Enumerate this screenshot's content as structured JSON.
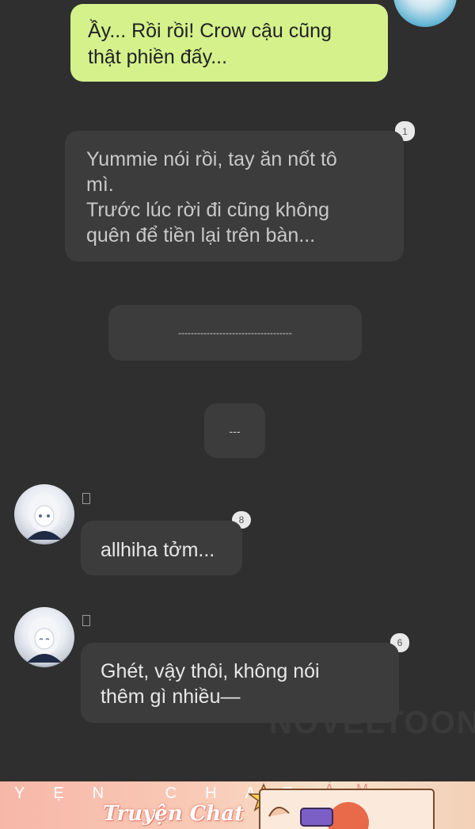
{
  "messages": [
    {
      "text": "Ầy... Rồi rồi! Crow cậu cũng\nthật phiền đấy..."
    },
    {
      "badge": "1",
      "text": "Yummie nói rồi, tay ăn nốt tô\nmì.\nTrước lúc rời đi cũng không\nquên để tiền lại trên bàn..."
    },
    {
      "text": "------------------------------------"
    },
    {
      "text": "---"
    },
    {
      "badge": "8",
      "text": "allhiha tởm..."
    },
    {
      "badge": "6",
      "text": "Ghét, vậy thôi, không nói\nthêm gì nhiều—"
    }
  ],
  "watermark": "NOVELTOON",
  "banner": {
    "left_letters": "YẸN CHAT.",
    "right_letters": "ÁM PHA",
    "title": "Truyện Chat"
  },
  "colors": {
    "background": "#2f2f2f",
    "green_bubble": "#d4f18b",
    "gray_bubble": "#3c3c3c",
    "banner": "#f7b7a8"
  }
}
